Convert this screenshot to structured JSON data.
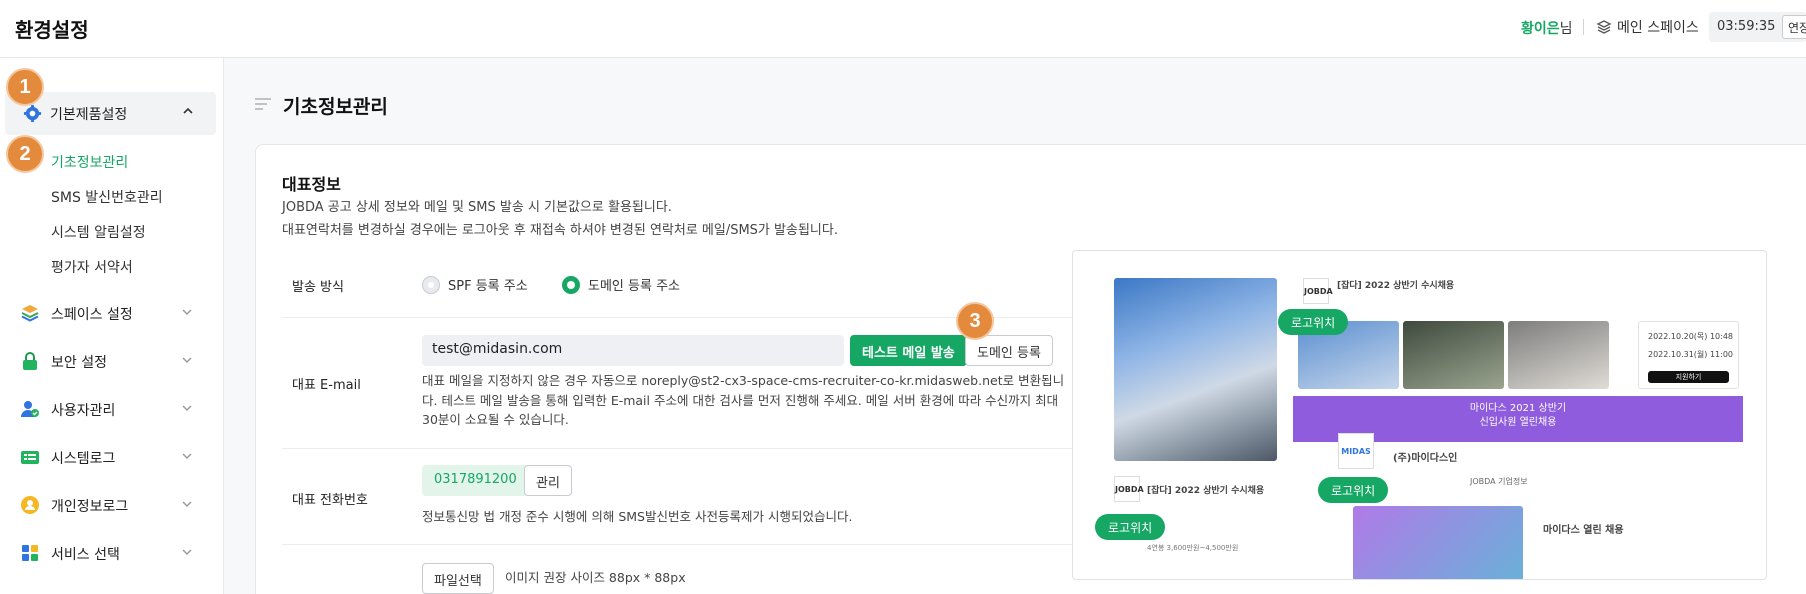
{
  "header": {
    "title": "환경설정",
    "user_name": "황이은",
    "user_suffix": "님",
    "space_label": "메인 스페이스",
    "timer": "03:59:35",
    "extend_label": "연장"
  },
  "sidebar": {
    "main_item": "기본제품설정",
    "sub_items": [
      "기초정보관리",
      "SMS 발신번호관리",
      "시스템 알림설정",
      "평가자 서약서"
    ],
    "items": [
      {
        "label": "스페이스 설정",
        "icon": "layers-icon"
      },
      {
        "label": "보안 설정",
        "icon": "lock-icon"
      },
      {
        "label": "사용자관리",
        "icon": "user-check-icon"
      },
      {
        "label": "시스템로그",
        "icon": "log-list-icon"
      },
      {
        "label": "개인정보로그",
        "icon": "person-coin-icon"
      },
      {
        "label": "서비스 선택",
        "icon": "apps-icon"
      }
    ]
  },
  "badges": [
    "1",
    "2",
    "3"
  ],
  "page": {
    "title": "기초정보관리",
    "section_title": "대표정보",
    "desc1": "JOBDA 공고 상세 정보와 메일 및 SMS 발송 시 기본값으로 활용됩니다.",
    "desc2": "대표연락처를 변경하실 경우에는 로그아웃 후 재접속 하셔야 변경된 연락처로 메일/SMS가 발송됩니다."
  },
  "form": {
    "send_method_label": "발송 방식",
    "radio_spf": "SPF 등록 주소",
    "radio_domain": "도메인 등록 주소",
    "email_label": "대표 E-mail",
    "email_value": "test@midasin.com",
    "test_mail_button": "테스트 메일 발송",
    "domain_register_button": "도메인 등록",
    "email_note": [
      "대표 메일을 지정하지 않은 경우 자동으로 noreply@st2-cx3-space-cms-recruiter-co-kr.midasweb.net로 변환됩니",
      "다. 테스트 메일 발송을 통해 입력한 E-mail 주소에 대한 검사를 먼저 진행해 주세요. 메일 서버 환경에 따라 수신까지 최대",
      "30분이 소요될 수 있습니다."
    ],
    "phone_label": "대표 전화번호",
    "phone_value": "0317891200",
    "manage_button": "관리",
    "phone_note": "정보통신망 법 개정 준수 시행에 의해 SMS발신번호 사전등록제가 시행되었습니다.",
    "file_button": "파일선택",
    "file_note": "이미지 권장 사이즈 88px * 88px"
  },
  "preview": {
    "logo_tag": "로고위치",
    "job_title_1": "[잡다] 2022 상반기 수시채용",
    "job_title_2": "[잡다] 2022 상반기 수시채용",
    "company_name": "(주)마이다스인",
    "banner_line1": "마이다스 2021 상반기",
    "banner_line2": "신입사원 열린채용",
    "event_title": "마이다스 열린 채용",
    "jobda_logo": "JOBDA",
    "midas_logo": "MIDAS",
    "apply_button": "지원하기",
    "date_1": "2022.10.20(목) 10:48",
    "date_2": "2022.10.31(월) 11:00",
    "salary": "4연봉 3,600만원~4,500만원",
    "tab_text": "JOBDA 기업정보"
  }
}
